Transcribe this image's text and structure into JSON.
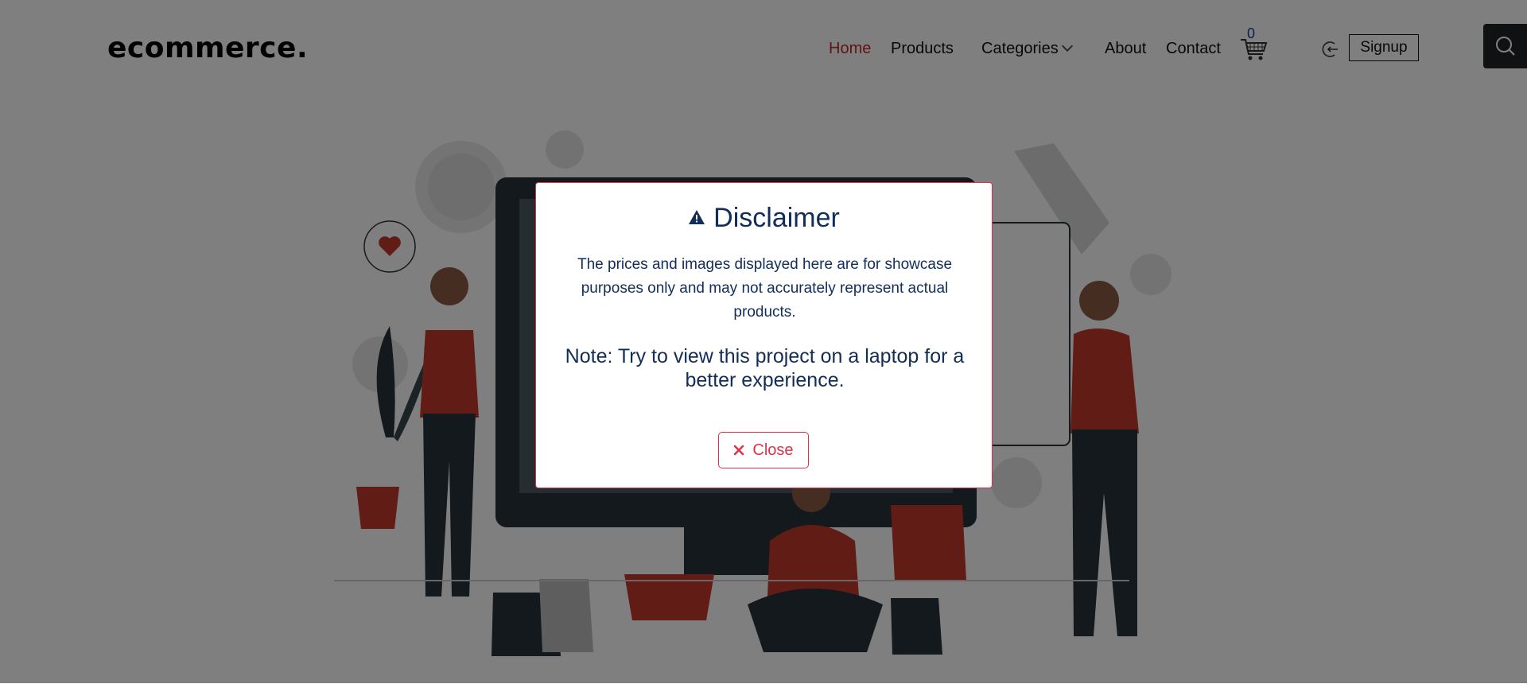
{
  "header": {
    "logo": "ecommerce.",
    "nav": {
      "home": "Home",
      "products": "Products",
      "categories": "Categories",
      "about": "About",
      "contact": "Contact"
    },
    "cart_count": "0",
    "signup_label": "Signup"
  },
  "modal": {
    "title": "Disclaimer",
    "text": "The prices and images displayed here are for showcase purposes only and may not accurately represent actual products.",
    "note": "Note: Try to view this project on a laptop for a better experience.",
    "close_label": "Close"
  },
  "colors": {
    "accent": "#c0282b",
    "modal_text": "#112d5a",
    "close_red": "#d9344a",
    "overlay": "rgba(0,0,0,0.5)"
  },
  "icons": [
    "cart-icon",
    "login-icon",
    "search-icon",
    "warning-icon",
    "close-icon",
    "chevron-down-icon"
  ]
}
